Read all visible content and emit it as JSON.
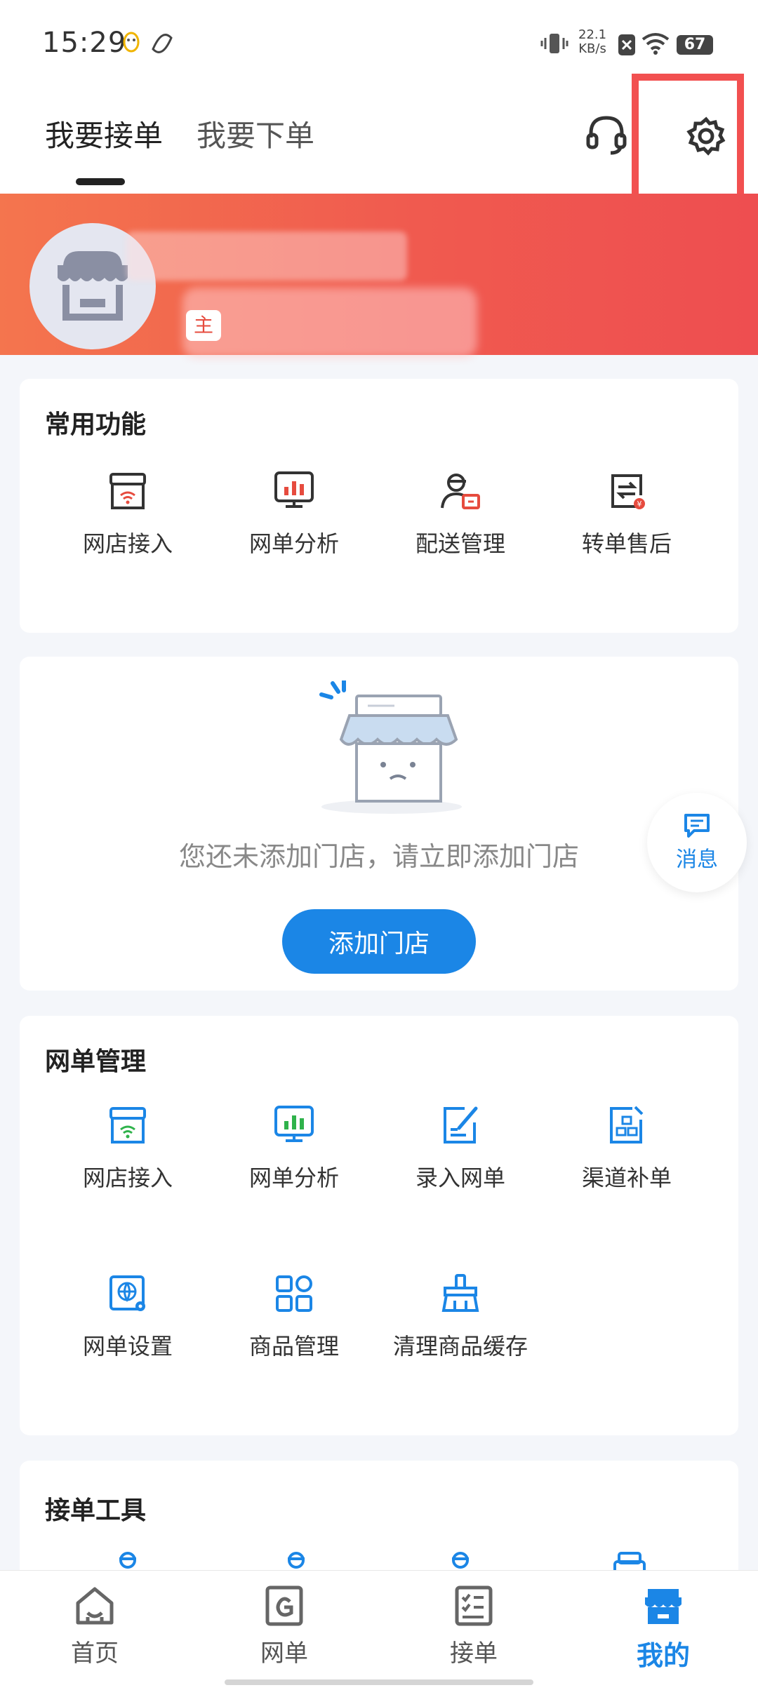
{
  "status_bar": {
    "time": "15:29",
    "net_speed_value": "22.1",
    "net_speed_unit": "KB/s",
    "battery": "67"
  },
  "header": {
    "tabs": [
      {
        "label": "我要接单",
        "active": true
      },
      {
        "label": "我要下单",
        "active": false
      }
    ],
    "icons": [
      "headset-icon",
      "gear-icon"
    ]
  },
  "banner": {
    "badge_text": "主"
  },
  "common_functions": {
    "title": "常用功能",
    "items": [
      {
        "label": "网店接入",
        "icon": "store-wifi-icon"
      },
      {
        "label": "网单分析",
        "icon": "chart-monitor-icon"
      },
      {
        "label": "配送管理",
        "icon": "courier-icon"
      },
      {
        "label": "转单售后",
        "icon": "transfer-icon"
      }
    ]
  },
  "empty_store": {
    "message": "您还未添加门店，请立即添加门店",
    "button_label": "添加门店"
  },
  "floating_message": {
    "label": "消息"
  },
  "order_management": {
    "title": "网单管理",
    "items": [
      {
        "label": "网店接入",
        "icon": "store-wifi-icon"
      },
      {
        "label": "网单分析",
        "icon": "chart-monitor-icon"
      },
      {
        "label": "录入网单",
        "icon": "edit-doc-icon"
      },
      {
        "label": "渠道补单",
        "icon": "channel-doc-icon"
      },
      {
        "label": "网单设置",
        "icon": "globe-settings-icon"
      },
      {
        "label": "商品管理",
        "icon": "grid-apps-icon"
      },
      {
        "label": "清理商品缓存",
        "icon": "broom-icon"
      }
    ]
  },
  "receiving_tools": {
    "title": "接单工具"
  },
  "bottom_nav": {
    "items": [
      {
        "label": "首页",
        "icon": "home-icon",
        "active": false
      },
      {
        "label": "网单",
        "icon": "order-icon",
        "active": false
      },
      {
        "label": "接单",
        "icon": "checklist-icon",
        "active": false
      },
      {
        "label": "我的",
        "icon": "store-icon",
        "active": true
      }
    ]
  },
  "colors": {
    "accent_blue": "#1b86e6",
    "banner_red": "#f05a4f",
    "icon_red": "#e64b3e"
  }
}
